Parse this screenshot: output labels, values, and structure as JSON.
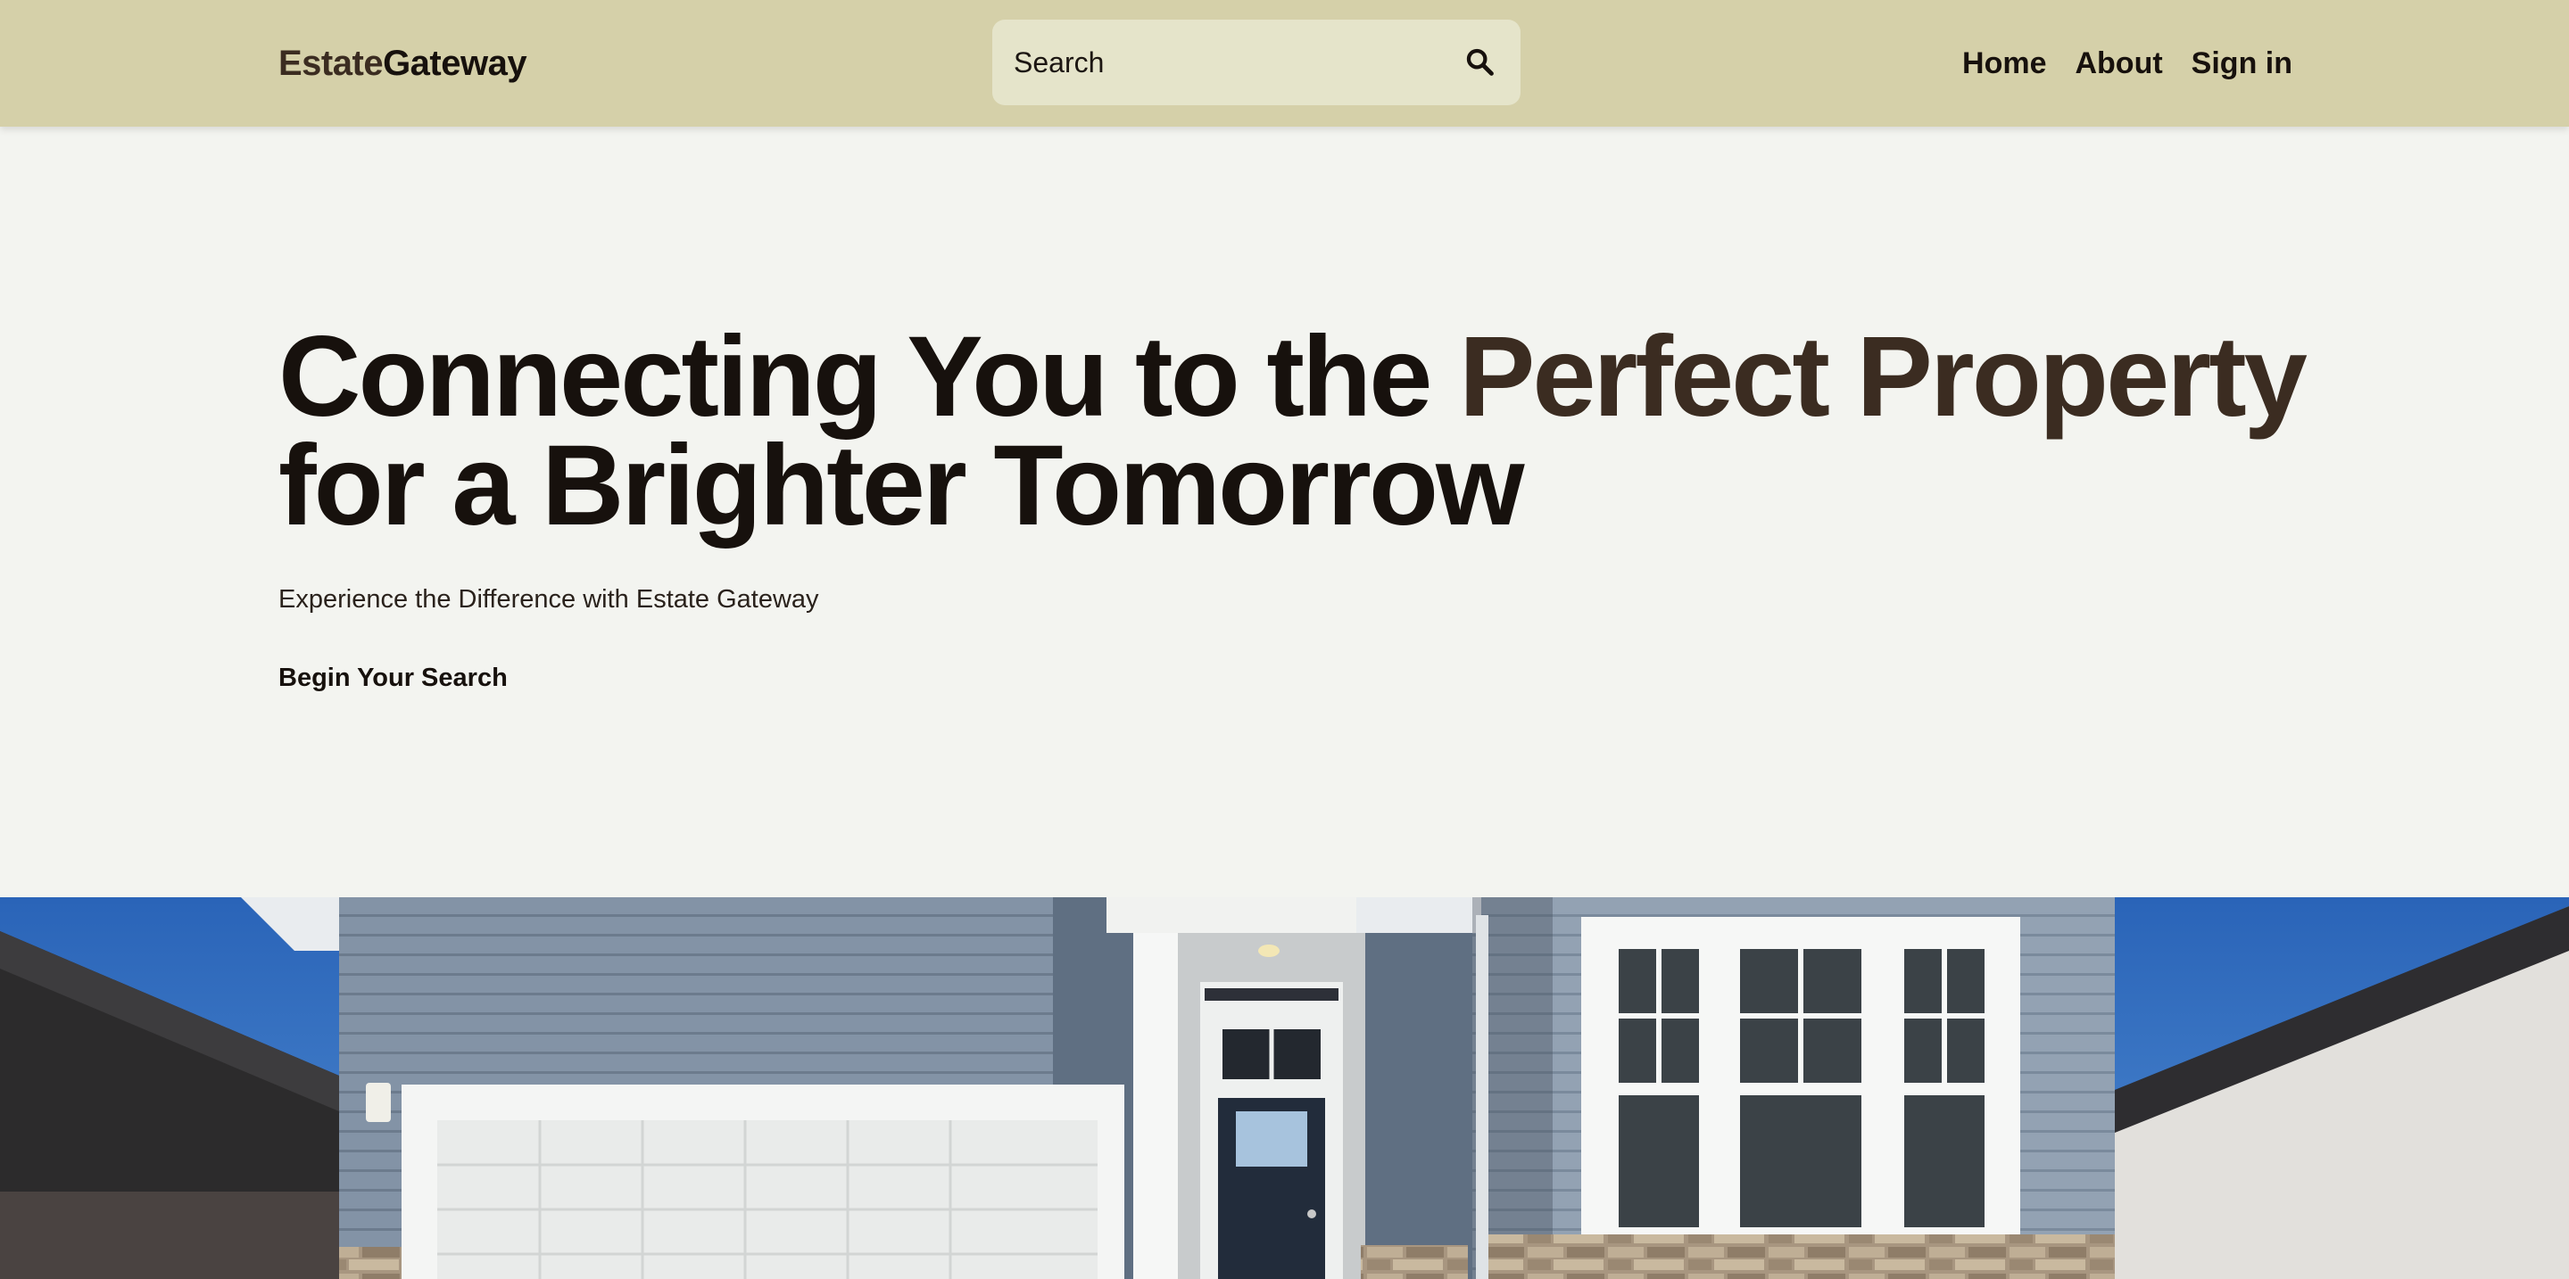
{
  "header": {
    "logo_part1": "Estate",
    "logo_part2": "Gateway",
    "search": {
      "placeholder": "Search"
    },
    "nav": {
      "home": "Home",
      "about": "About",
      "signin": "Sign in"
    }
  },
  "hero": {
    "title_part1": "Connecting You to the ",
    "title_accent": "Perfect Property",
    "title_part2": "for a Brighter Tomorrow",
    "subtitle": "Experience the Difference with Estate Gateway",
    "cta_label": "Begin Your Search"
  },
  "icons": {
    "search": "search-icon"
  },
  "colors": {
    "header_bg": "#d5d0a9",
    "page_bg": "#f3f4f0",
    "search_bg": "#e5e4ca",
    "text_dark": "#17110d",
    "accent_brown": "#3b2c21"
  }
}
